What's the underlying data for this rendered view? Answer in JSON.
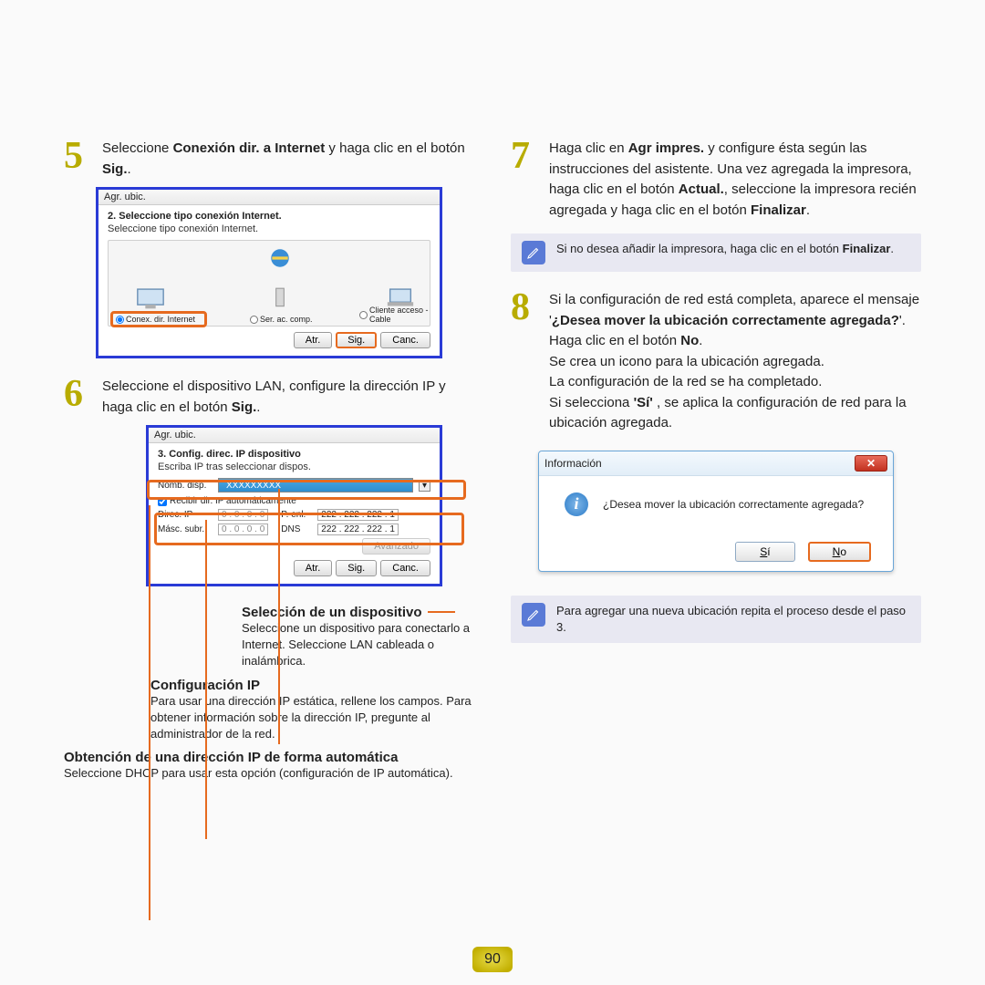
{
  "left": {
    "step5": {
      "num": "5",
      "text_a": "Seleccione ",
      "text_b": "Conexión dir. a Internet",
      "text_c": " y haga clic en el botón ",
      "text_d": "Sig.",
      "text_e": "."
    },
    "shot1": {
      "title": "Agr. ubic.",
      "line1": "2. Seleccione tipo conexión Internet.",
      "line2": "Seleccione tipo conexión Internet.",
      "opt1": "Conex. dir. Internet",
      "opt2": "Ser. ac. comp.",
      "opt3": "Cliente acceso - Cable",
      "btn_back": "Atr.",
      "btn_next": "Sig.",
      "btn_cancel": "Canc."
    },
    "step6": {
      "num": "6",
      "text_a": "Seleccione el dispositivo LAN, configure la dirección IP y haga clic en el botón ",
      "text_b": "Sig.",
      "text_c": "."
    },
    "shot2": {
      "title": "Agr. ubic.",
      "line1": "3. Config. direc. IP dispositivo",
      "line2": "Escriba IP tras seleccionar dispos.",
      "lbl_name": "Nomb. disp.",
      "name_val": "XXXXXXXXX",
      "chk": "Recibir dir. IP automáticamente",
      "lbl_ip": "Direc. IP",
      "ip_val": "0  .  0  .  0  .  0",
      "lbl_gw": "P. enl.",
      "gw_val": "222 . 222 . 222 .  1",
      "lbl_mask": "Másc. subr.",
      "mask_val": "0  .  0  .  0  .  0",
      "lbl_dns": "DNS",
      "dns_val": "222 . 222 . 222 .  1",
      "btn_adv": "Avanzado",
      "btn_back": "Atr.",
      "btn_next": "Sig.",
      "btn_cancel": "Canc."
    },
    "call1": {
      "h": "Selección de un dispositivo",
      "p": "Seleccione un dispositivo para conectarlo a Internet. Seleccione LAN cableada o inalámbrica."
    },
    "call2": {
      "h": "Configuración IP",
      "p": "Para usar una dirección IP estática, rellene los campos. Para obtener información sobre la dirección IP, pregunte al administrador de la red."
    },
    "call3": {
      "h": "Obtención de una dirección IP de forma automática",
      "p": "Seleccione DHCP para usar esta opción (configuración de IP automática)."
    }
  },
  "right": {
    "step7": {
      "num": "7",
      "t1": "Haga clic en ",
      "t2": "Agr impres.",
      "t3": " y configure ésta según las instrucciones del asistente. Una vez agregada la impresora, haga clic en el botón ",
      "t4": "Actual.",
      "t5": ", seleccione la impresora recién agregada y haga clic en el botón ",
      "t6": "Finalizar",
      "t7": "."
    },
    "note1a": "Si no desea añadir la impresora, haga clic en el botón ",
    "note1b": "Finalizar",
    "note1c": ".",
    "step8": {
      "num": "8",
      "t1": "Si la configuración de red está completa, aparece el mensaje '",
      "t2": "¿Desea mover la ubicación correctamente agregada?",
      "t3": "'. Haga clic en el botón ",
      "t4": "No",
      "t5": ".",
      "p2": "Se crea un icono para la ubicación agregada.",
      "p3": "La configuración de la red se ha completado.",
      "p4a": "Si selecciona ",
      "p4b": "'Sí'",
      "p4c": " , se aplica la configuración de red para la ubicación agregada."
    },
    "dialog": {
      "title": "Información",
      "msg": "¿Desea mover la ubicación correctamente agregada?",
      "yes_u": "S",
      "yes_r": "í",
      "no_u": "N",
      "no_r": "o"
    },
    "note2": "Para agregar una nueva ubicación repita el proceso desde el paso 3."
  },
  "pagenum": "90"
}
